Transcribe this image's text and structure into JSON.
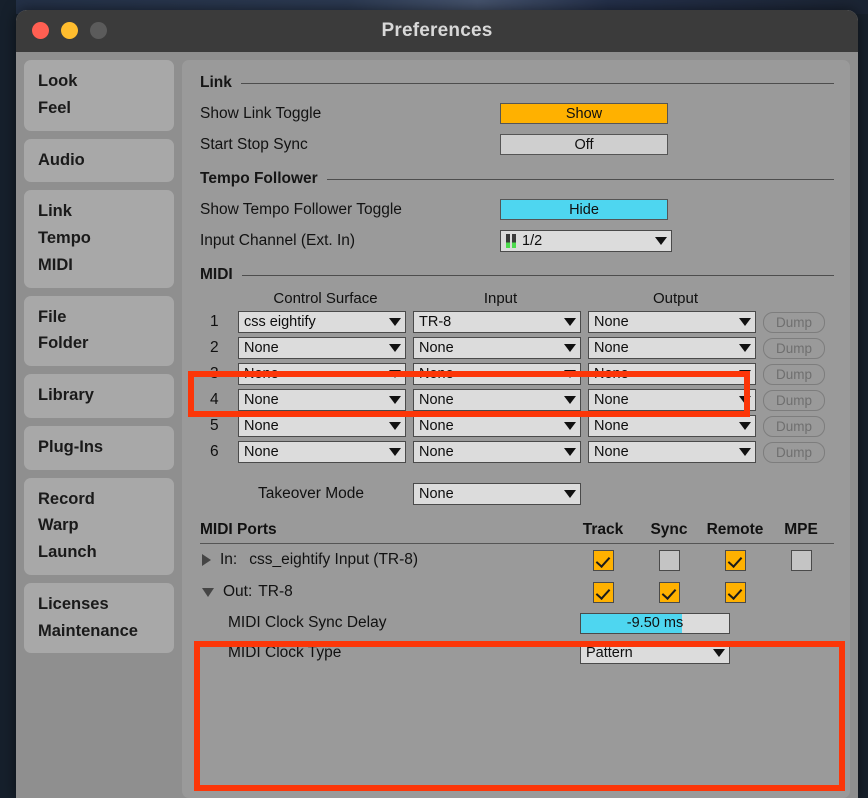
{
  "window": {
    "title": "Preferences",
    "traffic_lights": [
      "close-button",
      "minimize-button",
      "zoom-button"
    ]
  },
  "sidebar": {
    "groups": [
      {
        "items": [
          "Look",
          "Feel"
        ]
      },
      {
        "items": [
          "Audio"
        ]
      },
      {
        "items": [
          "Link",
          "Tempo",
          "MIDI"
        ]
      },
      {
        "items": [
          "File",
          "Folder"
        ]
      },
      {
        "items": [
          "Library"
        ]
      },
      {
        "items": [
          "Plug-Ins"
        ]
      },
      {
        "items": [
          "Record",
          "Warp",
          "Launch"
        ]
      },
      {
        "items": [
          "Licenses",
          "Maintenance"
        ]
      }
    ]
  },
  "sections": {
    "link": {
      "title": "Link",
      "rows": [
        {
          "label": "Show Link Toggle",
          "value": "Show",
          "style": "orange"
        },
        {
          "label": "Start Stop Sync",
          "value": "Off",
          "style": "gray"
        }
      ]
    },
    "tempo_follower": {
      "title": "Tempo Follower",
      "toggle_label": "Show Tempo Follower Toggle",
      "toggle_value": "Hide",
      "input_channel_label": "Input Channel (Ext. In)",
      "input_channel_value": "1/2"
    },
    "midi": {
      "title": "MIDI",
      "columns": [
        "Control Surface",
        "Input",
        "Output"
      ],
      "dump_label": "Dump",
      "rows": [
        {
          "num": "1",
          "control_surface": "css eightify",
          "input": "TR-8",
          "output": "None"
        },
        {
          "num": "2",
          "control_surface": "None",
          "input": "None",
          "output": "None"
        },
        {
          "num": "3",
          "control_surface": "None",
          "input": "None",
          "output": "None"
        },
        {
          "num": "4",
          "control_surface": "None",
          "input": "None",
          "output": "None"
        },
        {
          "num": "5",
          "control_surface": "None",
          "input": "None",
          "output": "None"
        },
        {
          "num": "6",
          "control_surface": "None",
          "input": "None",
          "output": "None"
        }
      ],
      "takeover_label": "Takeover Mode",
      "takeover_value": "None"
    },
    "midi_ports": {
      "title": "MIDI Ports",
      "columns": [
        "Track",
        "Sync",
        "Remote",
        "MPE"
      ],
      "ports": [
        {
          "direction": "In:",
          "name": "css_eightify Input (TR-8)",
          "expander": "triangle-right-icon",
          "track": true,
          "sync": false,
          "remote": true,
          "mpe": false,
          "has_mpe": true
        },
        {
          "direction": "Out:",
          "name": "TR-8",
          "expander": "triangle-down-icon",
          "track": true,
          "sync": true,
          "remote": true,
          "mpe": false,
          "has_mpe": false
        }
      ],
      "clock_sync_delay_label": "MIDI Clock Sync Delay",
      "clock_sync_delay_value": "-9.50 ms",
      "clock_sync_delay_fill_pct": "68",
      "clock_type_label": "MIDI Clock Type",
      "clock_type_value": "Pattern"
    }
  },
  "colors": {
    "accent_orange": "#ffb100",
    "accent_cyan": "#4ed6f0",
    "annotation_red": "#fc3608",
    "panel_gray": "#9a9a9a",
    "sidebar_group": "#a8a8a8"
  },
  "annotations": [
    {
      "name": "midi-row-1-highlight"
    },
    {
      "name": "midi-ports-highlight"
    }
  ]
}
